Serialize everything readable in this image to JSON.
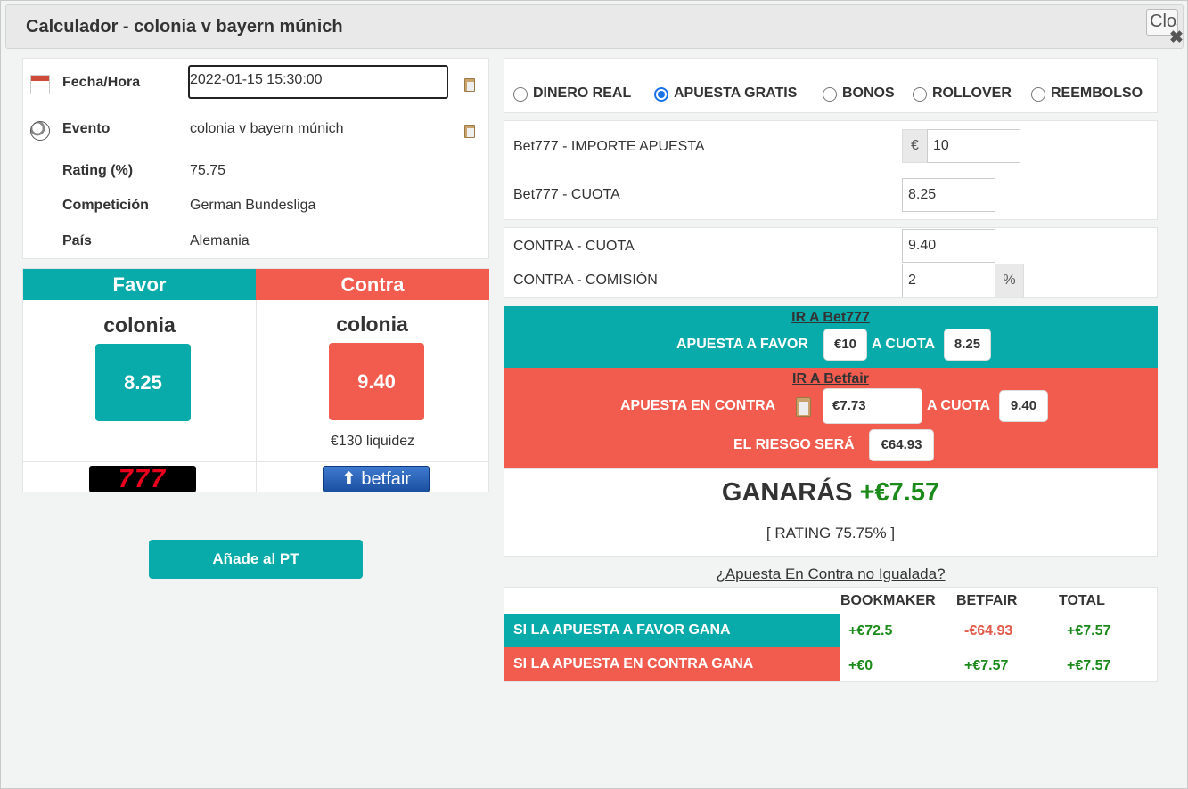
{
  "dialog": {
    "title": "Calculador - colonia v bayern múnich",
    "close_label": "Close"
  },
  "event": {
    "fecha_label": "Fecha/Hora",
    "fecha_value": "2022-01-15 15:30:00",
    "evento_label": "Evento",
    "evento_value": "colonia v bayern múnich",
    "rating_label": "Rating (%)",
    "rating_value": "75.75",
    "competicion_label": "Competición",
    "competicion_value": "German Bundesliga",
    "pais_label": "País",
    "pais_value": "Alemania"
  },
  "favor": {
    "header": "Favor",
    "team": "colonia",
    "odds": "8.25",
    "bookmaker_logo": "777"
  },
  "contra": {
    "header": "Contra",
    "team": "colonia",
    "odds": "9.40",
    "liquidity": "€130 liquidez",
    "exchange_logo": "betfair"
  },
  "add_button": "Añade al PT",
  "modes": {
    "options": [
      "DINERO REAL",
      "APUESTA GRATIS",
      "BONOS",
      "ROLLOVER",
      "REEMBOLSO"
    ],
    "selected": "APUESTA GRATIS"
  },
  "stake": {
    "importe_label": "Bet777 - IMPORTE APUESTA",
    "currency": "€",
    "importe_value": "10",
    "cuota_label": "Bet777 - CUOTA",
    "cuota_value": "8.25"
  },
  "lay": {
    "cuota_label": "CONTRA - CUOTA",
    "cuota_value": "9.40",
    "comision_label": "CONTRA - COMISIÓN",
    "comision_value": "2",
    "percent": "%"
  },
  "instructions": {
    "favor_link": "IR A Bet777",
    "favor_text": "APUESTA A FAVOR",
    "favor_amount": "€10",
    "a_cuota": "A CUOTA",
    "favor_odds": "8.25",
    "contra_link": "IR A Betfair",
    "contra_text": "APUESTA EN CONTRA",
    "contra_amount": "€7.73",
    "contra_odds": "9.40",
    "riesgo_text": "EL RIESGO SERÁ",
    "riesgo_amount": "€64.93"
  },
  "result": {
    "label": "GANARÁS",
    "amount": "+€7.57",
    "rating": "[ RATING 75.75% ]"
  },
  "unmatched_link": "¿Apuesta En Contra no Igualada?",
  "outcomes": {
    "headers": [
      "BOOKMAKER",
      "BETFAIR",
      "TOTAL"
    ],
    "rows": [
      {
        "label": "SI LA APUESTA A FAVOR GANA",
        "bookmaker": "+€72.5",
        "betfair": "-€64.93",
        "total": "+€7.57"
      },
      {
        "label": "SI LA APUESTA EN CONTRA GANA",
        "bookmaker": "+€0",
        "betfair": "+€7.57",
        "total": "+€7.57"
      }
    ]
  },
  "colors": {
    "teal": "#09aaaa",
    "red": "#f25c4f",
    "green": "#1b8a1b"
  }
}
